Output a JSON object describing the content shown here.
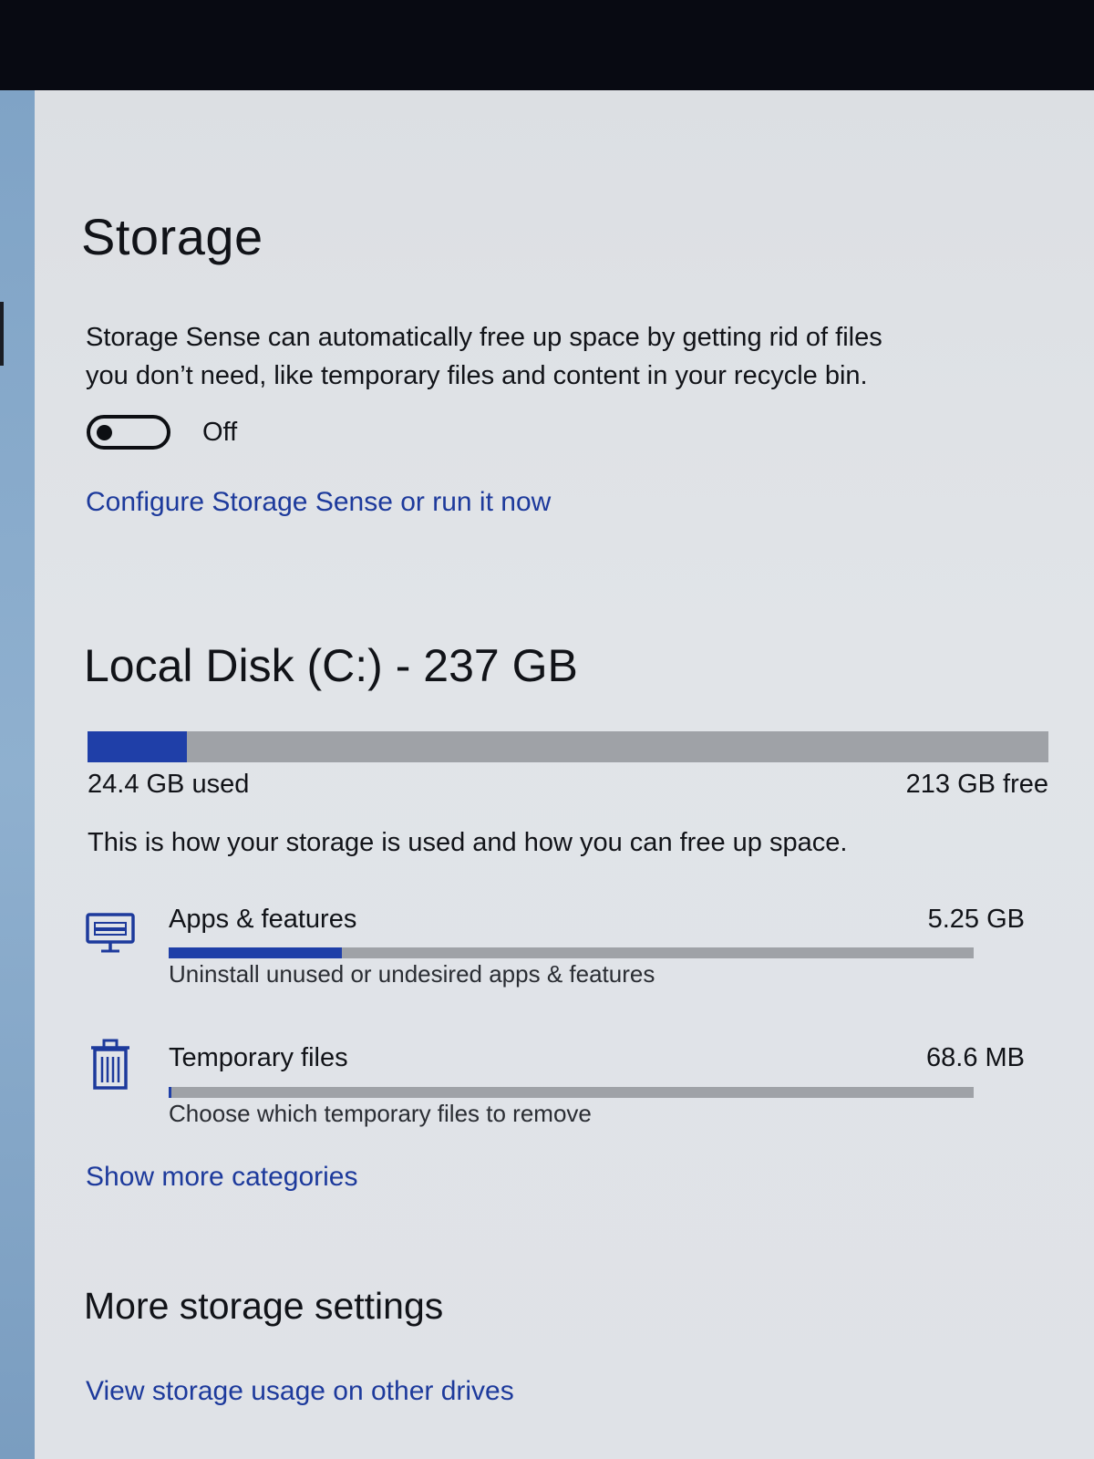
{
  "page": {
    "title": "Storage"
  },
  "storage_sense": {
    "description_line1": "Storage Sense can automatically free up space by getting rid of files",
    "description_line2": "you don’t need, like temporary files and content in your recycle bin.",
    "toggle_state": "Off",
    "toggle_on": false,
    "configure_link": "Configure Storage Sense or run it now"
  },
  "disk": {
    "title": "Local Disk (C:) - 237 GB",
    "used_label": "24.4 GB used",
    "free_label": "213 GB free",
    "used_fraction": 0.103,
    "intro": "This is how your storage is used and how you can free up space."
  },
  "categories": [
    {
      "icon": "apps-keyboard-icon",
      "name": "Apps & features",
      "size": "5.25 GB",
      "description": "Uninstall unused or undesired apps & features",
      "fraction": 0.215
    },
    {
      "icon": "trash-icon",
      "name": "Temporary files",
      "size": "68.6 MB",
      "description": "Choose which temporary files to remove",
      "fraction": 0.003
    }
  ],
  "show_more_link": "Show more categories",
  "more_settings": {
    "title": "More storage settings",
    "view_other_drives_link": "View storage usage on other drives"
  },
  "colors": {
    "accent": "#1f3fa8",
    "link": "#1d3a9c",
    "track": "#9fa2a7"
  }
}
